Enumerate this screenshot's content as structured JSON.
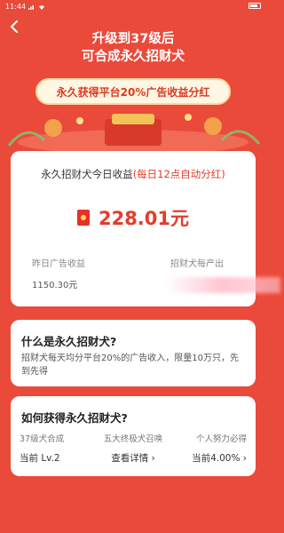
{
  "status_bar": {
    "time": "11:44"
  },
  "header": {
    "title_line1": "升级到37级后",
    "title_line2": "可合成永久招财犬",
    "banner": "永久获得平台20%广告收益分红"
  },
  "earnings": {
    "title": "永久招财犬今日收益",
    "title_hint": "(每日12点自动分红)",
    "amount": "228.01元",
    "yesterday_label": "昨日广告收益",
    "yesterday_value": "1150.30元",
    "output_label": "招财犬每产出"
  },
  "what": {
    "heading": "什么是永久招财犬?",
    "body": "招财犬每天均分平台20%的广告收入，限量10万只，先到先得"
  },
  "how": {
    "heading": "如何获得永久招财犬?",
    "methods": [
      "37级犬合成",
      "五大终极犬召唤",
      "个人努力必得"
    ],
    "statuses": [
      "当前 Lv.2",
      "查看详情 ›",
      "当前4.00% ›"
    ]
  },
  "colors": {
    "background": "#ea4a3a",
    "accent": "#e23d2a",
    "banner_bg": "#fff6e3"
  },
  "icons": [
    "back-arrow-icon",
    "red-envelope-icon"
  ]
}
